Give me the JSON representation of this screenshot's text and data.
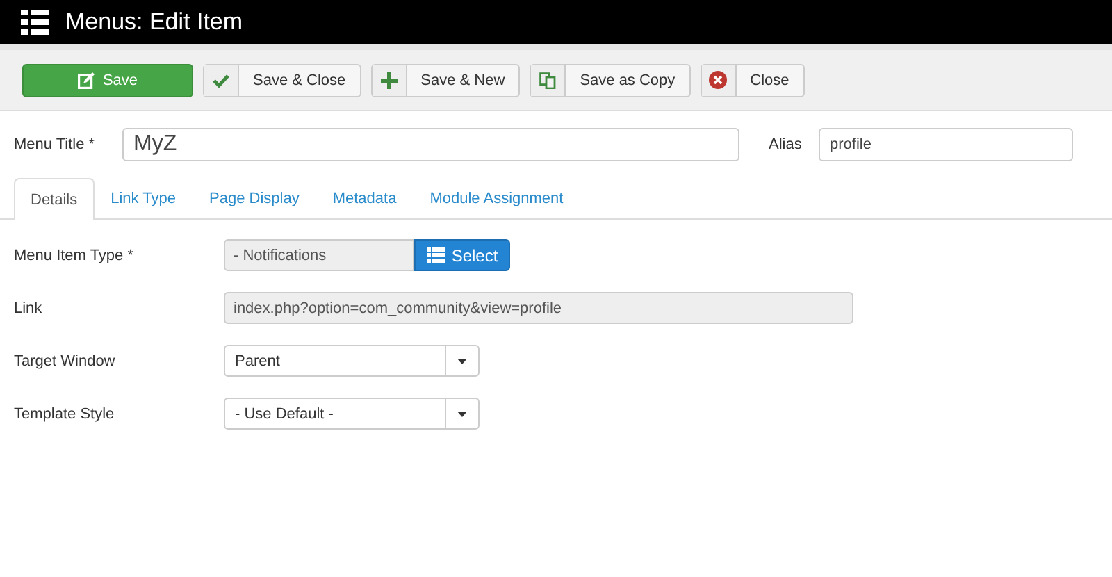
{
  "header": {
    "title": "Menus: Edit Item"
  },
  "toolbar": [
    {
      "label": "Save",
      "kind": "primary"
    },
    {
      "label": "Save & Close",
      "kind": "default"
    },
    {
      "label": "Save & New",
      "kind": "default"
    },
    {
      "label": "Save as Copy",
      "kind": "default"
    },
    {
      "label": "Close",
      "kind": "default"
    }
  ],
  "title_row": {
    "menu_title_label": "Menu Title *",
    "menu_title_value": "MyZ",
    "alias_label": "Alias",
    "alias_value": "profile"
  },
  "tabs": [
    {
      "label": "Details",
      "selected": true
    },
    {
      "label": "Link Type",
      "selected": false
    },
    {
      "label": "Page Display",
      "selected": false
    },
    {
      "label": "Metadata",
      "selected": false
    },
    {
      "label": "Module Assignment",
      "selected": false
    }
  ],
  "fields": [
    {
      "label": "Menu Item Type *",
      "kind": "picker",
      "value": "- Notifications",
      "button": "Select"
    },
    {
      "label": "Link",
      "kind": "readonly",
      "value": "index.php?option=com_community&view=profile"
    },
    {
      "label": "Target Window",
      "kind": "select",
      "value": "Parent"
    },
    {
      "label": "Template Style",
      "kind": "select",
      "value": "- Use Default -"
    }
  ]
}
